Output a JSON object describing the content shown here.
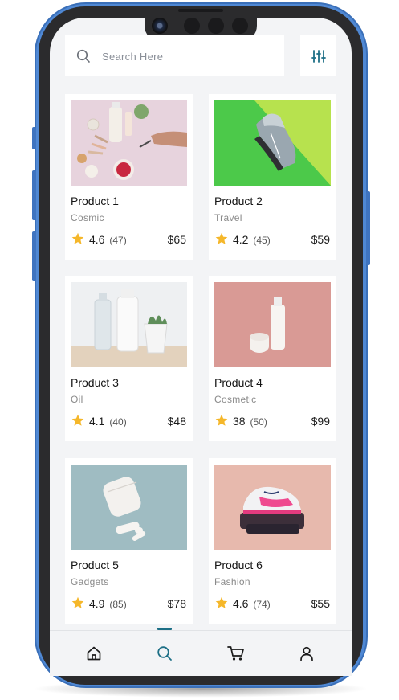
{
  "search": {
    "placeholder": "Search Here",
    "value": ""
  },
  "icons": {
    "search": "search-icon",
    "filter": "sliders-icon",
    "home": "home-icon",
    "search_nav": "search-icon",
    "cart": "cart-icon",
    "profile": "user-icon",
    "star": "star-icon"
  },
  "colors": {
    "accent": "#1d6f86",
    "star": "#f5b72a",
    "frame": "#4f88d4"
  },
  "products": [
    {
      "name": "Product 1",
      "category": "Cosmic",
      "rating": "4.6",
      "count": "(47)",
      "price": "$65"
    },
    {
      "name": "Product 2",
      "category": "Travel",
      "rating": "4.2",
      "count": "(45)",
      "price": "$59"
    },
    {
      "name": "Product 3",
      "category": "Oil",
      "rating": "4.1",
      "count": "(40)",
      "price": "$48"
    },
    {
      "name": "Product 4",
      "category": "Cosmetic",
      "rating": "38",
      "count": "(50)",
      "price": "$99"
    },
    {
      "name": "Product 5",
      "category": "Gadgets",
      "rating": "4.9",
      "count": "(85)",
      "price": "$78"
    },
    {
      "name": "Product 6",
      "category": "Fashion",
      "rating": "4.6",
      "count": "(74)",
      "price": "$55"
    }
  ],
  "nav": {
    "active": "search"
  }
}
